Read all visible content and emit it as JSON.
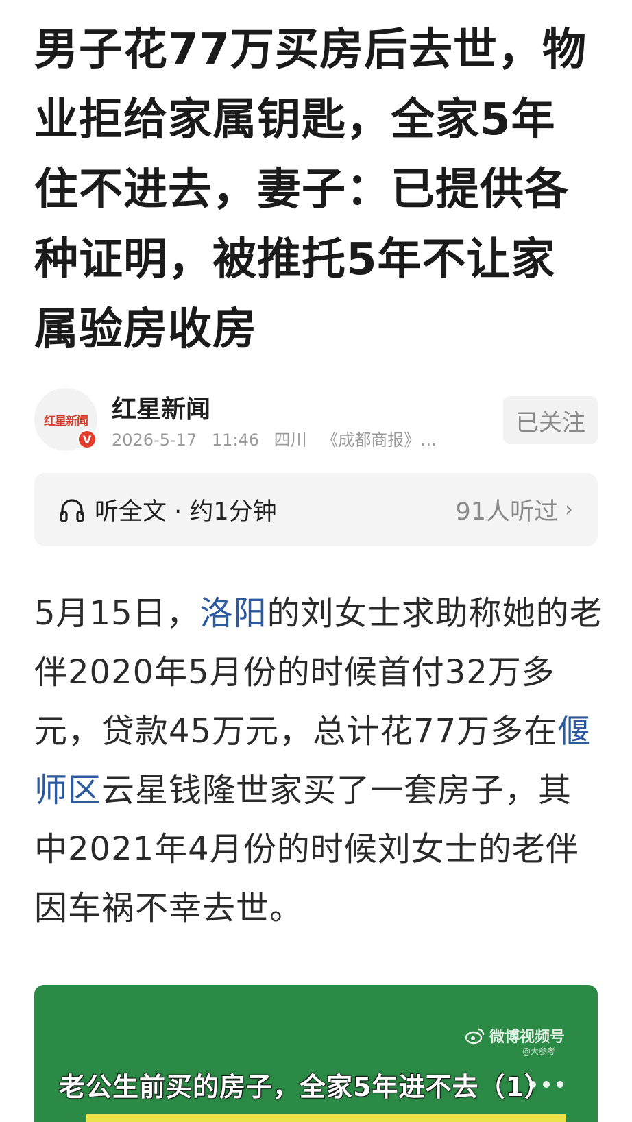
{
  "article": {
    "headline_lines": [
      "男子花77万买房后去世，物",
      "业拒给家属钥匙，全家5年",
      "住不进去，妻子：已提供各",
      "种证明，被推托5年不让家",
      "属验房收房"
    ]
  },
  "author": {
    "avatar_logo_text": "红星新闻",
    "verified_badge": "V",
    "name": "红星新闻",
    "date": "2026-5-17",
    "time": "11:46",
    "location": "四川",
    "source": "《成都商报》…",
    "follow_label": "已关注"
  },
  "listen": {
    "icon": "headphones-icon",
    "label": "听全文 · 约1分钟",
    "count": "91人听过",
    "chevron": "›"
  },
  "body": {
    "p1": "5月15日，",
    "link1": "洛阳",
    "p2": "的刘女士求助称她的老伴2020年5月份的时候首付32万多元，贷款45万元，总计花77万多在",
    "link2": "偃师区",
    "p3": "云星钱隆世家买了一套房子，其中2021年4月份的时候刘女士的老伴因车祸不幸去世。"
  },
  "video": {
    "watermark": "微博视频号",
    "watermark_sub": "@大参考",
    "caption": "老公生前买的房子，全家5年进不去（1）",
    "colors": {
      "background": "#2b8a45",
      "subbar": "#ece34b"
    }
  },
  "colors": {
    "link": "#2c5a9e",
    "verified": "#e33b2c",
    "muted": "#9a9a9a"
  }
}
